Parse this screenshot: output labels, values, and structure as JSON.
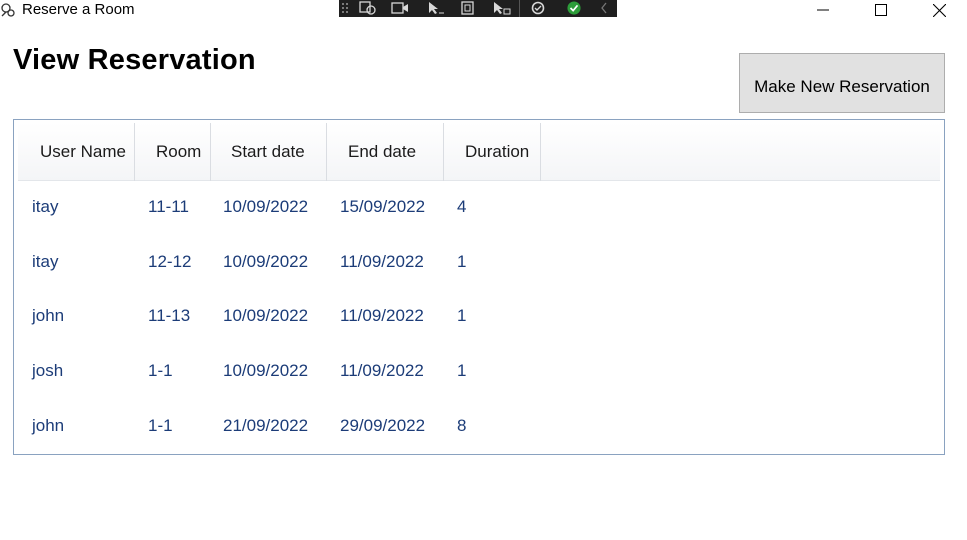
{
  "window": {
    "title": "Reserve a Room"
  },
  "page": {
    "title": "View Reservation",
    "new_reservation_label": "Make New Reservation"
  },
  "table": {
    "columns": [
      "User Name",
      "Room",
      "Start date",
      "End date",
      "Duration"
    ],
    "rows": [
      [
        "itay",
        "11-11",
        "10/09/2022",
        "15/09/2022",
        "4"
      ],
      [
        "itay",
        "12-12",
        "10/09/2022",
        "11/09/2022",
        "1"
      ],
      [
        "john",
        "11-13",
        "10/09/2022",
        "11/09/2022",
        "1"
      ],
      [
        "josh",
        "1-1",
        "10/09/2022",
        "11/09/2022",
        "1"
      ],
      [
        "john",
        "1-1",
        "21/09/2022",
        "29/09/2022",
        "8"
      ]
    ]
  },
  "colors": {
    "cell_text": "#1c3c78",
    "grid_border": "#8aa2c0",
    "button_bg": "#e1e1e1",
    "debug_toolbar_bg": "#1f1f1f"
  },
  "icons": {
    "app": "app-icon",
    "debug_toolbar": [
      "select-element-icon",
      "display-layout-icon",
      "track-focus-icon",
      "inspect-icon",
      "cursor-icon",
      "hot-reload-icon",
      "check-icon",
      "collapse-chevron-icon"
    ],
    "window_controls": [
      "minimize-icon",
      "maximize-icon",
      "close-icon"
    ]
  }
}
